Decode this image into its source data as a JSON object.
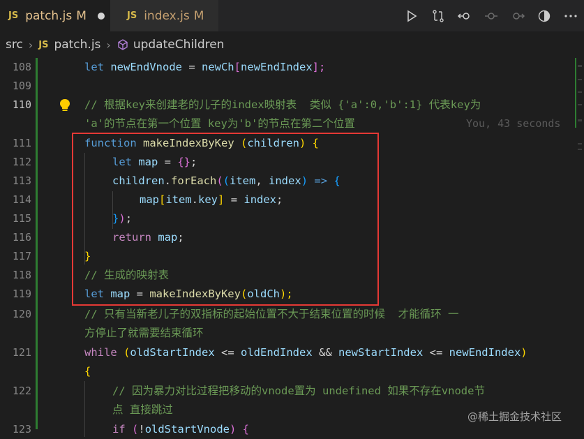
{
  "tabs": [
    {
      "lang": "JS",
      "name": "patch.js",
      "status": "M"
    },
    {
      "lang": "JS",
      "name": "index.js",
      "status": "M"
    }
  ],
  "breadcrumb": {
    "folder": "src",
    "file_lang": "JS",
    "file": "patch.js",
    "symbol": "updateChildren"
  },
  "blame": "You, 43 seconds",
  "watermark": "@稀土掘金技术社区",
  "line_numbers": [
    "108",
    "109",
    "110",
    "",
    "111",
    "112",
    "113",
    "114",
    "115",
    "116",
    "117",
    "118",
    "119",
    "120",
    "",
    "121",
    "",
    "122",
    "",
    "123"
  ],
  "code": {
    "l108_a": "let ",
    "l108_b": "newEndVnode",
    "l108_c": " = ",
    "l108_d": "newCh",
    "l108_e": "[",
    "l108_f": "newEndIndex",
    "l108_g": "];",
    "l110": "// 根据key来创建老的儿子的index映射表  类似 {'a':0,'b':1} 代表key为",
    "l110w": "'a'的节点在第一个位置 key为'b'的节点在第二个位置",
    "l111_a": "function ",
    "l111_b": "makeIndexByKey",
    "l111_c": " (",
    "l111_d": "children",
    "l111_e": ") ",
    "l111_f": "{",
    "l112_a": "let ",
    "l112_b": "map",
    "l112_c": " = ",
    "l112_d": "{}",
    "l112_e": ";",
    "l113_a": "children",
    "l113_b": ".",
    "l113_c": "forEach",
    "l113_d": "(",
    "l113_e": "(",
    "l113_f": "item",
    "l113_g": ", ",
    "l113_h": "index",
    "l113_i": ") ",
    "l113_j": "=>",
    "l113_k": " {",
    "l114_a": "map",
    "l114_b": "[",
    "l114_c": "item",
    "l114_d": ".",
    "l114_e": "key",
    "l114_f": "]",
    "l114_g": " = ",
    "l114_h": "index",
    "l114_i": ";",
    "l115_a": "}",
    "l115_b": ")",
    "l115_c": ";",
    "l116_a": "return ",
    "l116_b": "map",
    "l116_c": ";",
    "l117": "}",
    "l118": "// 生成的映射表",
    "l119_a": "let ",
    "l119_b": "map",
    "l119_c": " = ",
    "l119_d": "makeIndexByKey",
    "l119_e": "(",
    "l119_f": "oldCh",
    "l119_g": ");",
    "l120": "// 只有当新老儿子的双指标的起始位置不大于结束位置的时候  才能循环 一",
    "l120w": "方停止了就需要结束循环",
    "l121_a": "while ",
    "l121_b": "(",
    "l121_c": "oldStartIndex",
    "l121_d": " <= ",
    "l121_e": "oldEndIndex",
    "l121_f": " && ",
    "l121_g": "newStartIndex",
    "l121_h": " <= ",
    "l121_i": "newEndIndex",
    "l121_j": ")",
    "l121w": "{",
    "l122": "// 因为暴力对比过程把移动的vnode置为 undefined 如果不存在vnode节",
    "l122w": "点 直接跳过",
    "l123_a": "if ",
    "l123_b": "(",
    "l123_c": "!",
    "l123_d": "oldStartVnode",
    "l123_e": ") {"
  },
  "colors": {
    "gutter_modified": "#2e7d32",
    "highlight_box": "#e53935"
  },
  "icons": [
    "run-icon",
    "compare-changes-icon",
    "go-back-icon",
    "go-forward-dot-icon",
    "go-forward-icon",
    "toggle-icon",
    "more-icon"
  ]
}
